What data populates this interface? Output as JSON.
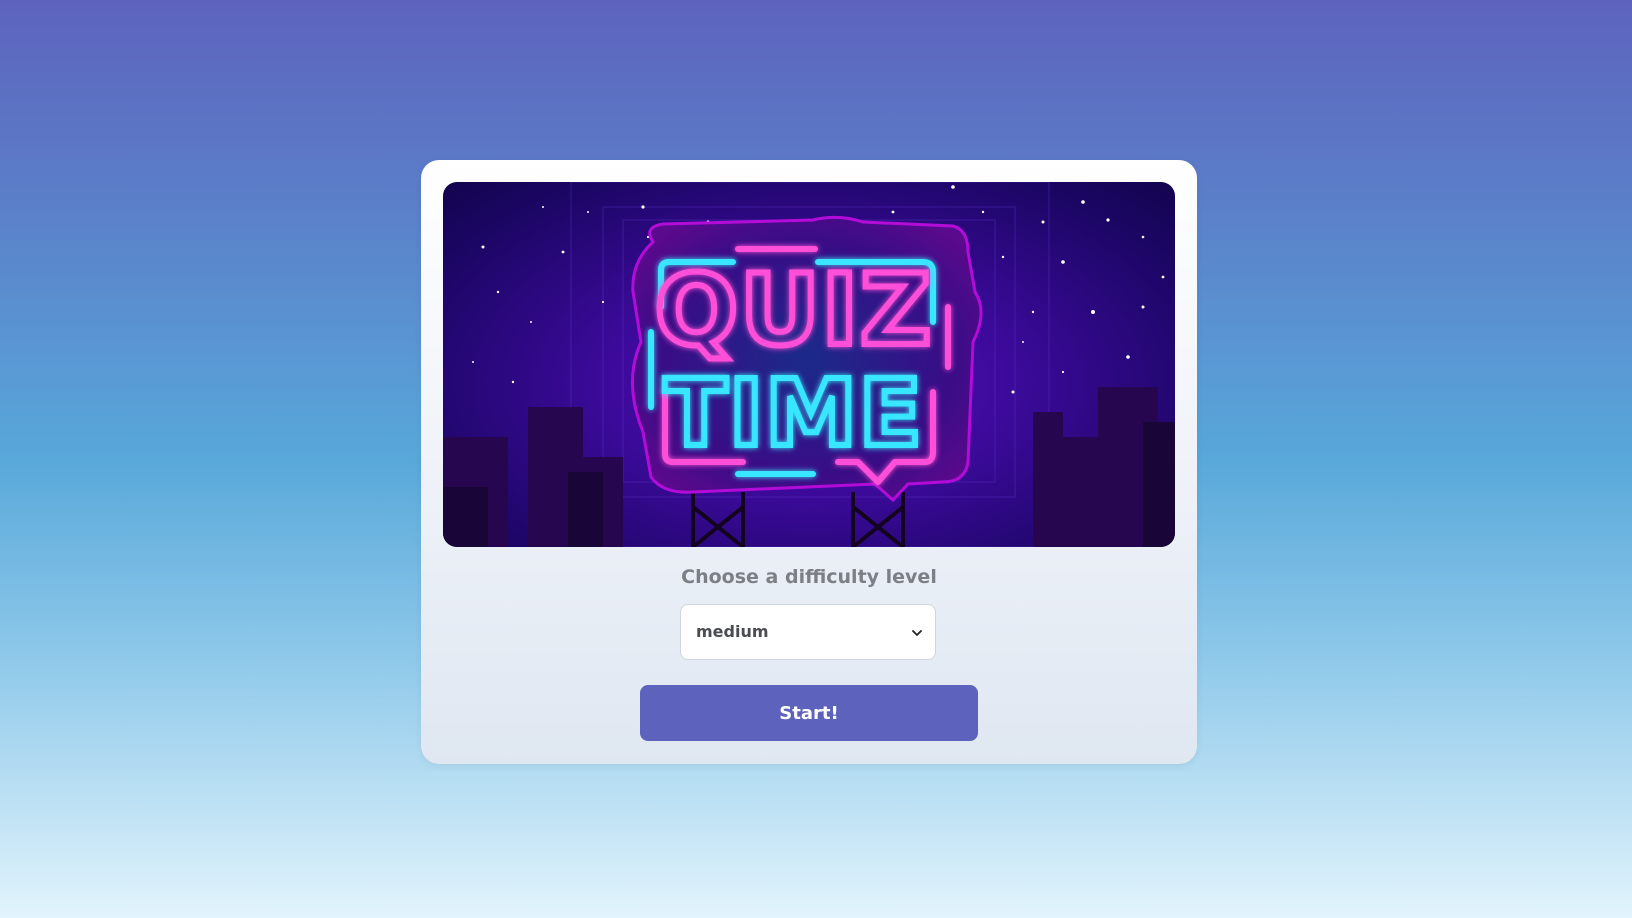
{
  "hero": {
    "sign_line_1": "QUIZ",
    "sign_line_2": "TIME"
  },
  "difficulty": {
    "label": "Choose a difficulty level",
    "selected": "medium"
  },
  "start_button": {
    "label": "Start!"
  },
  "colors": {
    "accent": "#5d63bd",
    "neon_pink": "#ff4fd8",
    "neon_cyan": "#39e6ff"
  }
}
